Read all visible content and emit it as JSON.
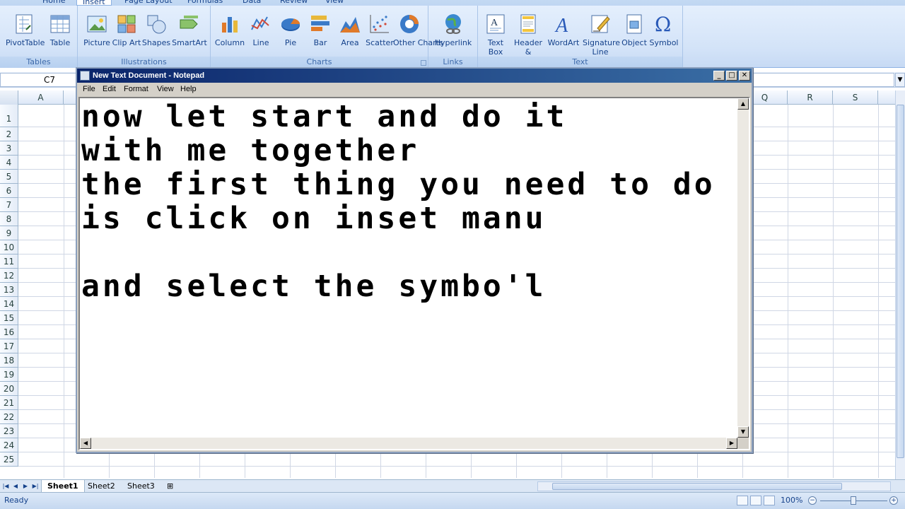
{
  "ribbon_tabs": [
    "Home",
    "Insert",
    "Page Layout",
    "Formulas",
    "Data",
    "Review",
    "View"
  ],
  "groups": {
    "tables": {
      "label": "Tables",
      "buttons": [
        "PivotTable",
        "Table"
      ]
    },
    "illustrations": {
      "label": "Illustrations",
      "buttons": [
        "Picture",
        "Clip Art",
        "Shapes",
        "SmartArt"
      ]
    },
    "charts": {
      "label": "Charts",
      "buttons": [
        "Column",
        "Line",
        "Pie",
        "Bar",
        "Area",
        "Scatter",
        "Other Charts"
      ]
    },
    "links": {
      "label": "Links",
      "buttons": [
        "Hyperlink"
      ]
    },
    "text": {
      "label": "Text",
      "buttons": [
        "Text Box",
        "Header & Footer",
        "WordArt",
        "Signature Line",
        "Object",
        "Symbol"
      ]
    }
  },
  "name_box": "C7",
  "columns": [
    "A",
    "Q",
    "R",
    "S"
  ],
  "rows": [
    "1",
    "2",
    "3",
    "4",
    "5",
    "6",
    "7",
    "8",
    "9",
    "10",
    "11",
    "12",
    "13",
    "14",
    "15",
    "16",
    "17",
    "18",
    "19",
    "20",
    "21",
    "22",
    "23",
    "24",
    "25"
  ],
  "sheets": [
    "Sheet1",
    "Sheet2",
    "Sheet3"
  ],
  "status": {
    "ready": "Ready",
    "zoom": "100%"
  },
  "notepad": {
    "title": "New Text Document - Notepad",
    "menu": [
      "File",
      "Edit",
      "Format",
      "View",
      "Help"
    ],
    "content": "now let start and do it\nwith me together\nthe first thing you need to do\nis click on inset manu\n\nand select the symbo'l"
  },
  "colors": {
    "accent": "#15428b",
    "ribbon": "#d3e3f8",
    "titlebar": "#0a246a"
  }
}
